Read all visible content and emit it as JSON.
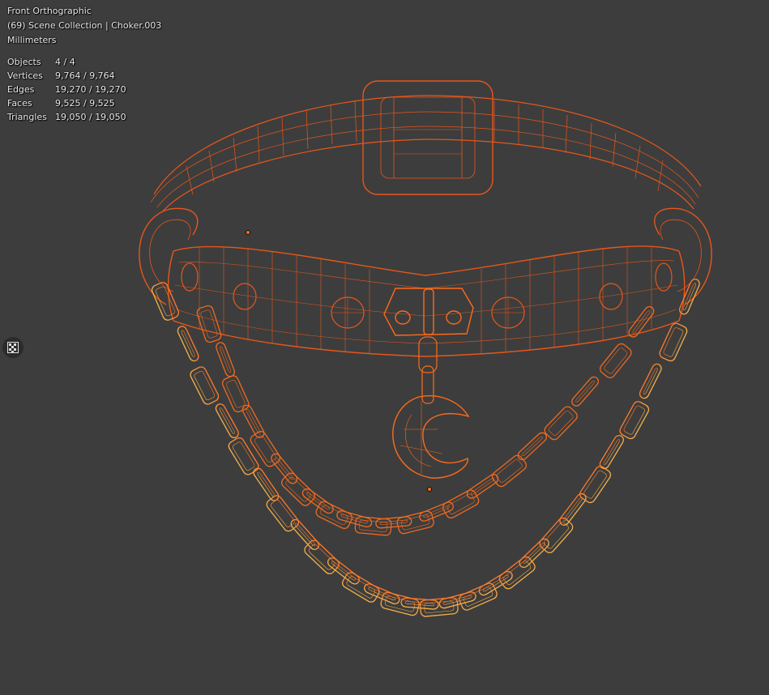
{
  "viewport": {
    "view_name": "Front Orthographic",
    "collection_line": "(69) Scene Collection | Choker.003",
    "units": "Millimeters"
  },
  "stats": [
    {
      "label": "Objects",
      "value": "4 / 4"
    },
    {
      "label": "Vertices",
      "value": "9,764 / 9,764"
    },
    {
      "label": "Edges",
      "value": "19,270 / 19,270"
    },
    {
      "label": "Faces",
      "value": "9,525 / 9,525"
    },
    {
      "label": "Triangles",
      "value": "19,050 / 19,050"
    }
  ],
  "colors": {
    "background": "#3d3d3d",
    "active_wire": "#ff6a1a",
    "selected_wire": "#e8561a",
    "chain_outer_wire": "#f2a23a",
    "text": "#e8e8e8"
  },
  "side_widget": {
    "icon": "checker-icon"
  }
}
